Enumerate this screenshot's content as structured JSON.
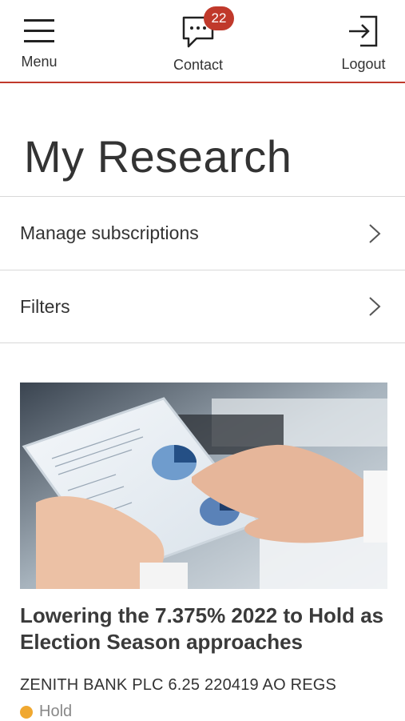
{
  "header": {
    "menu_label": "Menu",
    "contact_label": "Contact",
    "contact_badge": "22",
    "logout_label": "Logout",
    "accent_color": "#c0392b"
  },
  "page": {
    "title": "My Research"
  },
  "rows": [
    {
      "label": "Manage subscriptions",
      "icon": "chevron-right-icon"
    },
    {
      "label": "Filters",
      "icon": "chevron-right-icon"
    }
  ],
  "research_card": {
    "image_desc": "hands-on-tablet-with-pie-charts",
    "title": "Lowering the 7.375% 2022 to Hold as Election Season approaches",
    "issuer": "ZENITH BANK PLC 6.25 220419 AO REGS",
    "rating": "Hold",
    "rating_color": "#f0a830"
  }
}
